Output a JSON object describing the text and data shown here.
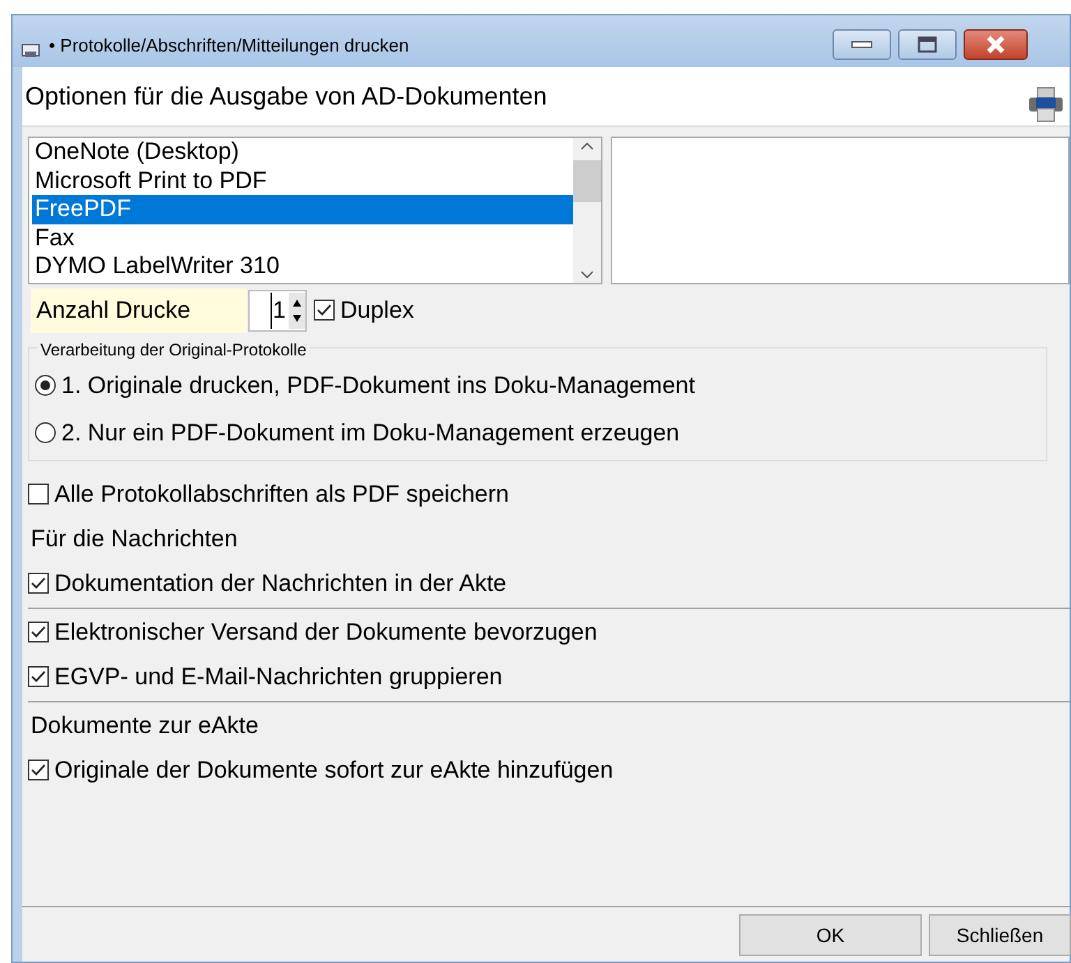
{
  "window": {
    "title": "• Protokolle/Abschriften/Mitteilungen drucken"
  },
  "header": {
    "title": "Optionen für die Ausgabe von AD-Dokumenten"
  },
  "printers": [
    {
      "label": "OneNote (Desktop)",
      "selected": false
    },
    {
      "label": "Microsoft Print to PDF",
      "selected": false
    },
    {
      "label": "FreePDF",
      "selected": true
    },
    {
      "label": "Fax",
      "selected": false
    },
    {
      "label": "DYMO LabelWriter 310",
      "selected": false
    }
  ],
  "copies": {
    "label": "Anzahl Drucke",
    "value": "1"
  },
  "duplex": {
    "label": "Duplex",
    "checked": true
  },
  "group": {
    "legend": "Verarbeitung der Original-Protokolle",
    "options": [
      {
        "label": "1. Originale drucken, PDF-Dokument ins Doku-Management",
        "selected": true
      },
      {
        "label": "2. Nur ein PDF-Dokument im Doku-Management erzeugen",
        "selected": false
      }
    ]
  },
  "options": [
    {
      "kind": "checkbox",
      "label": "Alle Protokollabschriften als PDF speichern",
      "checked": false
    },
    {
      "kind": "heading",
      "label": "Für die Nachrichten"
    },
    {
      "kind": "checkbox",
      "label": "Dokumentation der Nachrichten in der Akte",
      "checked": true
    },
    {
      "kind": "separator"
    },
    {
      "kind": "checkbox",
      "label": "Elektronischer Versand der Dokumente bevorzugen",
      "checked": true
    },
    {
      "kind": "checkbox",
      "label": "EGVP- und E-Mail-Nachrichten gruppieren",
      "checked": true
    },
    {
      "kind": "separator"
    },
    {
      "kind": "heading",
      "label": "Dokumente zur eAkte"
    },
    {
      "kind": "checkbox",
      "label": "Originale der Dokumente sofort zur eAkte hinzufügen",
      "checked": true
    }
  ],
  "buttons": [
    "OK",
    "Schließen"
  ]
}
